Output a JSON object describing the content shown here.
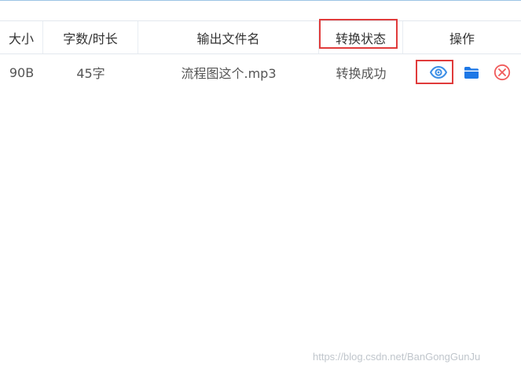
{
  "table": {
    "columns": {
      "size": "大小",
      "count_duration": "字数/时长",
      "output_filename": "输出文件名",
      "status": "转换状态",
      "actions": "操作"
    },
    "rows": [
      {
        "size": "90B",
        "count_duration": "45字",
        "output_filename": "流程图这个.mp3",
        "status": "转换成功",
        "actions": [
          {
            "icon": "eye-icon",
            "label": "view",
            "color": "#3b8ee6",
            "highlighted": true
          },
          {
            "icon": "folder-icon",
            "label": "open-folder",
            "color": "#1e78e6"
          },
          {
            "icon": "close-circle-icon",
            "label": "delete",
            "color": "#f05a5a"
          }
        ]
      }
    ]
  },
  "highlight_color": "#e03b3b",
  "header_border_color": "#e3e8ee",
  "watermark": "https://blog.csdn.net/BanGongGunJu"
}
